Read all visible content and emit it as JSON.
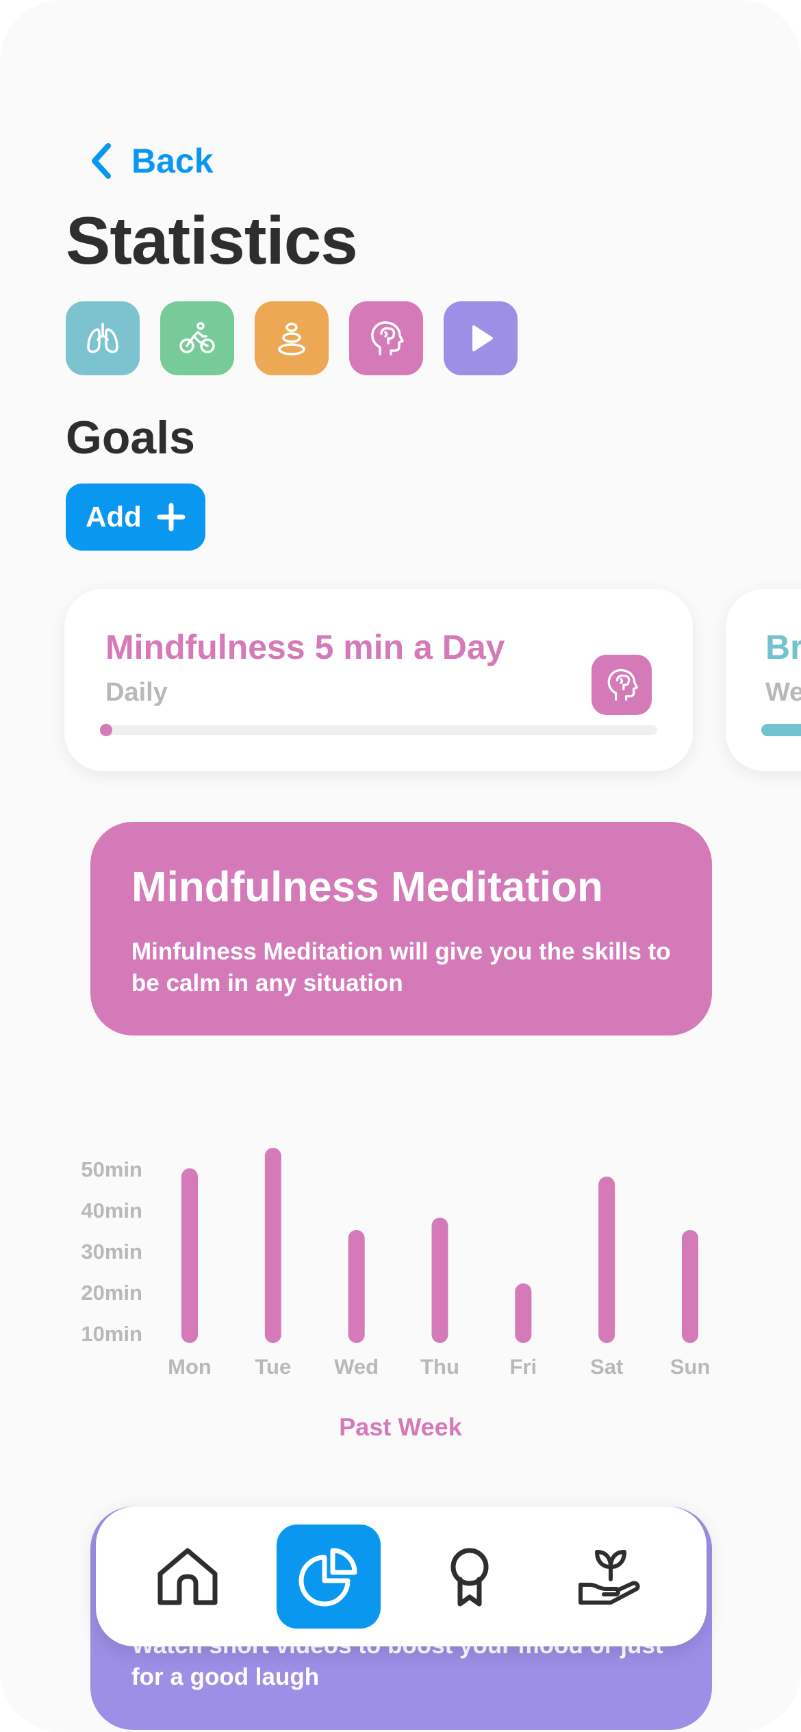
{
  "nav_top": {
    "back_label": "Back"
  },
  "page": {
    "title": "Statistics"
  },
  "categories": [
    {
      "name": "lungs-icon",
      "color": "#7dc3cf"
    },
    {
      "name": "cycling-icon",
      "color": "#76cb99"
    },
    {
      "name": "stones-icon",
      "color": "#eda855"
    },
    {
      "name": "brain-head-icon",
      "color": "#d57ab8"
    },
    {
      "name": "play-icon",
      "color": "#9d8fe6"
    }
  ],
  "goals": {
    "heading": "Goals",
    "add_label": "Add",
    "cards": [
      {
        "title": "Mindfulness 5 min a Day",
        "frequency": "Daily",
        "progress": 0,
        "color": "#d57ab8",
        "icon": "brain-head-icon"
      },
      {
        "title": "Br",
        "frequency": "We",
        "color": "#72c2cf"
      }
    ]
  },
  "info_card": {
    "title": "Mindfulness Meditation",
    "description": "Minfulness Meditation will give you the skills to be calm in any situation",
    "color": "#d57ab8"
  },
  "chart_data": {
    "type": "bar",
    "categories": [
      "Mon",
      "Tue",
      "Wed",
      "Thu",
      "Fri",
      "Sat",
      "Sun"
    ],
    "values": [
      50,
      55,
      35,
      38,
      22,
      48,
      35
    ],
    "y_ticks": [
      "10min",
      "20min",
      "30min",
      "40min",
      "50min"
    ],
    "xlabel": "Past Week",
    "ylim": [
      10,
      50
    ],
    "color": "#d57ab8",
    "grid": false
  },
  "promo_card": {
    "description": "Watch short videos to boost your mood or just for a good laugh",
    "color": "#9d8fe6"
  },
  "bottom_nav": {
    "items": [
      "home-icon",
      "stats-icon",
      "award-icon",
      "plant-hand-icon"
    ],
    "active_index": 1,
    "active_color": "#0a97f0"
  }
}
